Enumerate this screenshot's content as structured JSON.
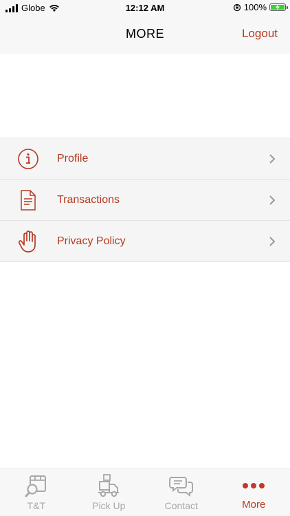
{
  "status_bar": {
    "carrier": "Globe",
    "time": "12:12 AM",
    "battery": "100%",
    "icons": [
      "signal-icon",
      "wifi-icon",
      "rotation-lock-icon",
      "battery-icon"
    ]
  },
  "header": {
    "title": "MORE",
    "logout_label": "Logout"
  },
  "menu": {
    "items": [
      {
        "label": "Profile",
        "icon": "info-icon"
      },
      {
        "label": "Transactions",
        "icon": "document-icon"
      },
      {
        "label": "Privacy Policy",
        "icon": "hand-icon"
      }
    ]
  },
  "tabs": [
    {
      "label": "T&T",
      "icon": "track-trace-icon",
      "active": false
    },
    {
      "label": "Pick Up",
      "icon": "delivery-truck-icon",
      "active": false
    },
    {
      "label": "Contact",
      "icon": "chat-bubbles-icon",
      "active": false
    },
    {
      "label": "More",
      "icon": "more-dots-icon",
      "active": true
    }
  ],
  "colors": {
    "accent": "#b43a22",
    "inactive": "#a8a8a8",
    "bar_background": "#f7f7f7"
  }
}
